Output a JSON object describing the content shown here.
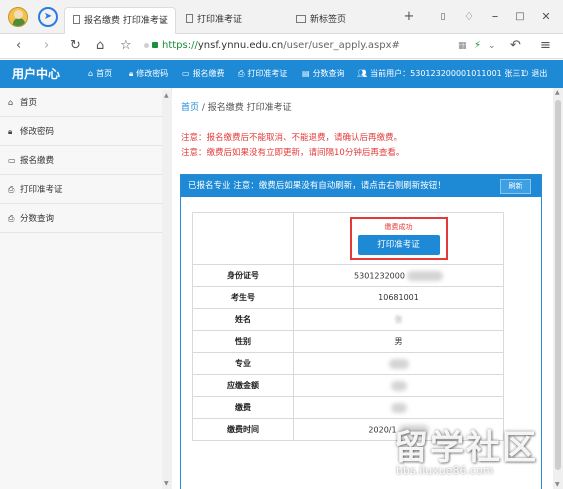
{
  "browser": {
    "tabs": [
      {
        "label": "报名缴费 打印准考证"
      },
      {
        "label": "打印准考证"
      },
      {
        "label": "新标签页"
      }
    ],
    "close_glyph": "×",
    "new_tab_glyph": "+",
    "url_scheme": "https://",
    "url_host": "ynsf.ynnu.edu.cn",
    "url_path": "/user/user_apply.aspx#",
    "nav_glyphs": {
      "back": "‹",
      "forward": "›",
      "reload": "↻",
      "home": "⌂",
      "star": "☆",
      "menu": "≡",
      "undo": "↶",
      "minimize": "–",
      "maximize": "□",
      "close": "✕"
    }
  },
  "site": {
    "brand": "用户中心",
    "nav": [
      {
        "icon": "home-icon",
        "glyph": "⌂",
        "label": "首页"
      },
      {
        "icon": "lock-icon",
        "glyph": "🔒︎",
        "label": "修改密码"
      },
      {
        "icon": "card-icon",
        "glyph": "▭",
        "label": "报名缴费"
      },
      {
        "icon": "print-icon",
        "glyph": "⎙",
        "label": "打印准考证"
      },
      {
        "icon": "score-icon",
        "glyph": "▤",
        "label": "分数查询"
      },
      {
        "icon": "user-icon",
        "glyph": "👥︎",
        "label": "当前用户：530123200001011001 张三1"
      },
      {
        "icon": "logout-icon",
        "glyph": "⏻",
        "label": "退出"
      }
    ]
  },
  "sidebar": {
    "items": [
      {
        "icon": "home-icon",
        "glyph": "⌂",
        "label": "首页"
      },
      {
        "icon": "lock-icon",
        "glyph": "🔒︎",
        "label": "修改密码"
      },
      {
        "icon": "card-icon",
        "glyph": "▭",
        "label": "报名缴费"
      },
      {
        "icon": "print-icon",
        "glyph": "⎙",
        "label": "打印准考证"
      },
      {
        "icon": "score-icon",
        "glyph": "⎙",
        "label": "分数查询"
      }
    ]
  },
  "main": {
    "breadcrumb_home": "首页",
    "breadcrumb_sep": " / ",
    "breadcrumb_current": "报名缴费 打印准考证",
    "notice1": "注意：报名缴费后不能取消、不能退费，请确认后再缴费。",
    "notice2": "注意：缴费后如果没有立即更新，请间隔10分钟后再查看。",
    "panel_title": "已报名专业 注意：缴费后如果没有自动刷新，请点击右侧刷新按钮！",
    "refresh_label": "刷新",
    "success_text": "缴费成功",
    "print_button": "打印准考证",
    "rows": [
      {
        "label": "身份证号",
        "value": "5301232000"
      },
      {
        "label": "考生号",
        "value": "10681001"
      },
      {
        "label": "姓名",
        "value": "张"
      },
      {
        "label": "性别",
        "value": "男"
      },
      {
        "label": "专业",
        "value": ""
      },
      {
        "label": "应缴金额",
        "value": ""
      },
      {
        "label": "缴费",
        "value": ""
      },
      {
        "label": "缴费时间",
        "value": "2020/1"
      }
    ]
  },
  "watermark": {
    "main": "留学社区",
    "sub": "bbs.liuxue86.com"
  }
}
